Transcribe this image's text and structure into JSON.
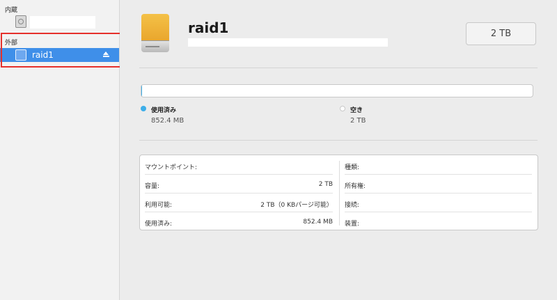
{
  "sidebar": {
    "sections": [
      {
        "header": "内蔵"
      },
      {
        "header": "外部",
        "items": [
          {
            "label": "raid1"
          }
        ]
      }
    ]
  },
  "disk": {
    "title": "raid1",
    "size_badge": "2 TB",
    "used_fraction": 0.0004
  },
  "legend": {
    "used": {
      "label": "使用済み",
      "value": "852.4 MB",
      "color": "#3daee9"
    },
    "free": {
      "label": "空き",
      "value": "2 TB",
      "color": "#ffffff"
    }
  },
  "info": {
    "left": [
      {
        "key": "マウントポイント:",
        "value": ""
      },
      {
        "key": "容量:",
        "value": "2 TB"
      },
      {
        "key": "利用可能:",
        "value": "2 TB（0 KBパージ可能）"
      },
      {
        "key": "使用済み:",
        "value": "852.4 MB"
      }
    ],
    "right": [
      {
        "key": "種類:",
        "value": ""
      },
      {
        "key": "所有権:",
        "value": ""
      },
      {
        "key": "接続:",
        "value": ""
      },
      {
        "key": "装置:",
        "value": ""
      }
    ]
  },
  "colors": {
    "selection": "#3f8fe9",
    "highlight": "#e5302b",
    "drive": "#f4c147"
  },
  "icons": [
    "internal-disk-icon",
    "external-disk-icon",
    "eject-icon",
    "external-drive-icon"
  ]
}
